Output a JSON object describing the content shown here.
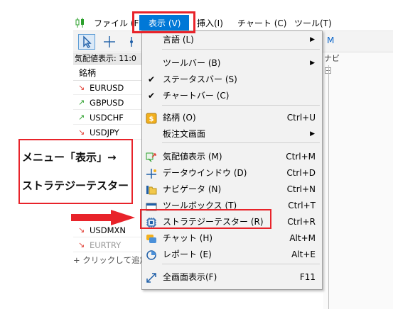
{
  "menubar": {
    "items": [
      "ファイル (F",
      "表示 (V)",
      "挿入(I)",
      "チャート (C)",
      "ツール(T)"
    ]
  },
  "toolbar": {
    "right_label": "M"
  },
  "market_watch": {
    "title": "気配値表示: 11:0",
    "header": "銘柄",
    "rows": [
      {
        "symbol": "EURUSD",
        "dir": "down"
      },
      {
        "symbol": "GBPUSD",
        "dir": "up"
      },
      {
        "symbol": "USDCHF",
        "dir": "up"
      },
      {
        "symbol": "USDJPY",
        "dir": "down"
      },
      {
        "symbol": "USDMXN",
        "dir": "down"
      },
      {
        "symbol": "EURTRY",
        "dir": "down"
      }
    ],
    "add_label": "+ クリックして追加"
  },
  "right_panel": {
    "partial_text": "ナビ"
  },
  "view_menu": {
    "items": [
      {
        "label": "言語 (L)",
        "shortcut": "",
        "submenu": true,
        "icon": "",
        "checked": false
      },
      {
        "label": "ツールバー (B)",
        "shortcut": "",
        "submenu": true,
        "icon": "",
        "checked": false
      },
      {
        "label": "ステータスバー (S)",
        "shortcut": "",
        "submenu": false,
        "icon": "",
        "checked": true
      },
      {
        "label": "チャートバー (C)",
        "shortcut": "",
        "submenu": false,
        "icon": "",
        "checked": true
      },
      {
        "label": "銘柄 (O)",
        "shortcut": "Ctrl+U",
        "submenu": false,
        "icon": "dollar-icon",
        "checked": false
      },
      {
        "label": "板注文画面",
        "shortcut": "",
        "submenu": true,
        "icon": "",
        "checked": false
      },
      {
        "label": "気配値表示 (M)",
        "shortcut": "Ctrl+M",
        "submenu": false,
        "icon": "market-watch-icon",
        "checked": false
      },
      {
        "label": "データウインドウ (D)",
        "shortcut": "Ctrl+D",
        "submenu": false,
        "icon": "crosshair-icon",
        "checked": false
      },
      {
        "label": "ナビゲータ (N)",
        "shortcut": "Ctrl+N",
        "submenu": false,
        "icon": "folder-icon",
        "checked": false
      },
      {
        "label": "ツールボックス (T)",
        "shortcut": "Ctrl+T",
        "submenu": false,
        "icon": "toolbox-icon",
        "checked": false
      },
      {
        "label": "ストラテジーテスター (R)",
        "shortcut": "Ctrl+R",
        "submenu": false,
        "icon": "chip-icon",
        "checked": false
      },
      {
        "label": "チャット (H)",
        "shortcut": "Alt+M",
        "submenu": false,
        "icon": "chat-icon",
        "checked": false
      },
      {
        "label": "レポート (E)",
        "shortcut": "Alt+E",
        "submenu": false,
        "icon": "report-icon",
        "checked": false
      },
      {
        "label": "全画面表示(F)",
        "shortcut": "F11",
        "submenu": false,
        "icon": "fullscreen-icon",
        "checked": false
      }
    ]
  },
  "callout": {
    "line1": "メニュー「表示」→",
    "line2": "ストラテジーテスター"
  },
  "colors": {
    "highlight": "#e8232a",
    "menu_selected": "#0078d7"
  }
}
